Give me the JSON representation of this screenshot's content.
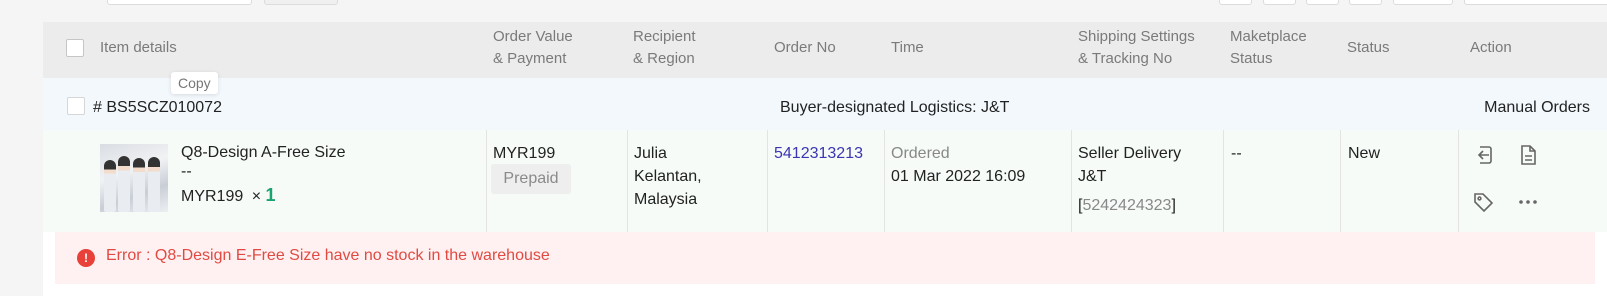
{
  "table": {
    "headers": {
      "item_details": "Item details",
      "order_value": "Order Value\n& Payment",
      "recipient": "Recipient\n& Region",
      "order_no": "Order No",
      "time": "Time",
      "shipping": "Shipping Settings\n& Tracking No",
      "marketplace": "Maketplace\nStatus",
      "status": "Status",
      "action": "Action"
    }
  },
  "order": {
    "number": "# BS5SCZ010072",
    "copy_tooltip": "Copy",
    "logistics": "Buyer-designated Logistics: J&T",
    "type": "Manual Orders",
    "item": {
      "name": "Q8-Design A-Free Size",
      "variant": "--",
      "price": "MYR199",
      "times": "×",
      "quantity": "1"
    },
    "value": "MYR199",
    "payment": "Prepaid",
    "recipient_name": "Julia",
    "region_line1": "Kelantan,",
    "region_line2": "Malaysia",
    "order_no": "5412313213",
    "time_label": "Ordered",
    "time": "01 Mar 2022 16:09",
    "shipping_method": "Seller Delivery",
    "carrier": "J&T",
    "tracking_open": "[",
    "tracking_no": "5242424323",
    "tracking_close": "]",
    "marketplace_status": "--",
    "status": "New",
    "error": "Error : Q8-Design E-Free Size have no stock in the warehouse"
  },
  "colors": {
    "accent_green": "#1aa36f",
    "link_blue": "#3b35b3",
    "error_red": "#e14a42",
    "error_bg": "#fff1f1"
  },
  "icons": {
    "actions": [
      "import-icon",
      "document-icon",
      "tag-icon",
      "more-icon"
    ],
    "error": "error-circle-icon"
  }
}
